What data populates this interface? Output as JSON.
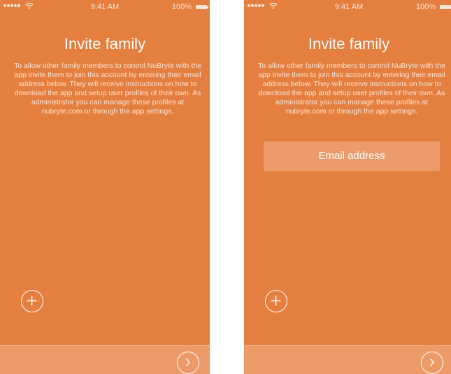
{
  "status_bar": {
    "time": "9:41 AM",
    "battery": "100%"
  },
  "screens": [
    {
      "title": "Invite family",
      "description": "To allow other family members to control NuBryte with the app invite them to join this account by entering their email address below. They will receive instructions on how to download the app and setup user profiles of their own. As administrator you can manage these profiles at nubryte.com or through the app settings."
    },
    {
      "title": "Invite family",
      "description": "To allow other family members to control NuBryte with the app invite them to join this account by entering their email address below. They will receive instructions on how to download the app and setup user profiles of their own. As administrator you can manage these profiles at nubryte.com or through the app settings.",
      "email_placeholder": "Email address"
    }
  ],
  "colors": {
    "background": "#e57f40",
    "field": "#ec9c6c",
    "bottom_bar": "#ec9a68"
  },
  "icons": {
    "add": "plus-circle-icon",
    "next": "chevron-right-circle-icon",
    "wifi": "wifi-icon",
    "battery": "battery-icon"
  }
}
